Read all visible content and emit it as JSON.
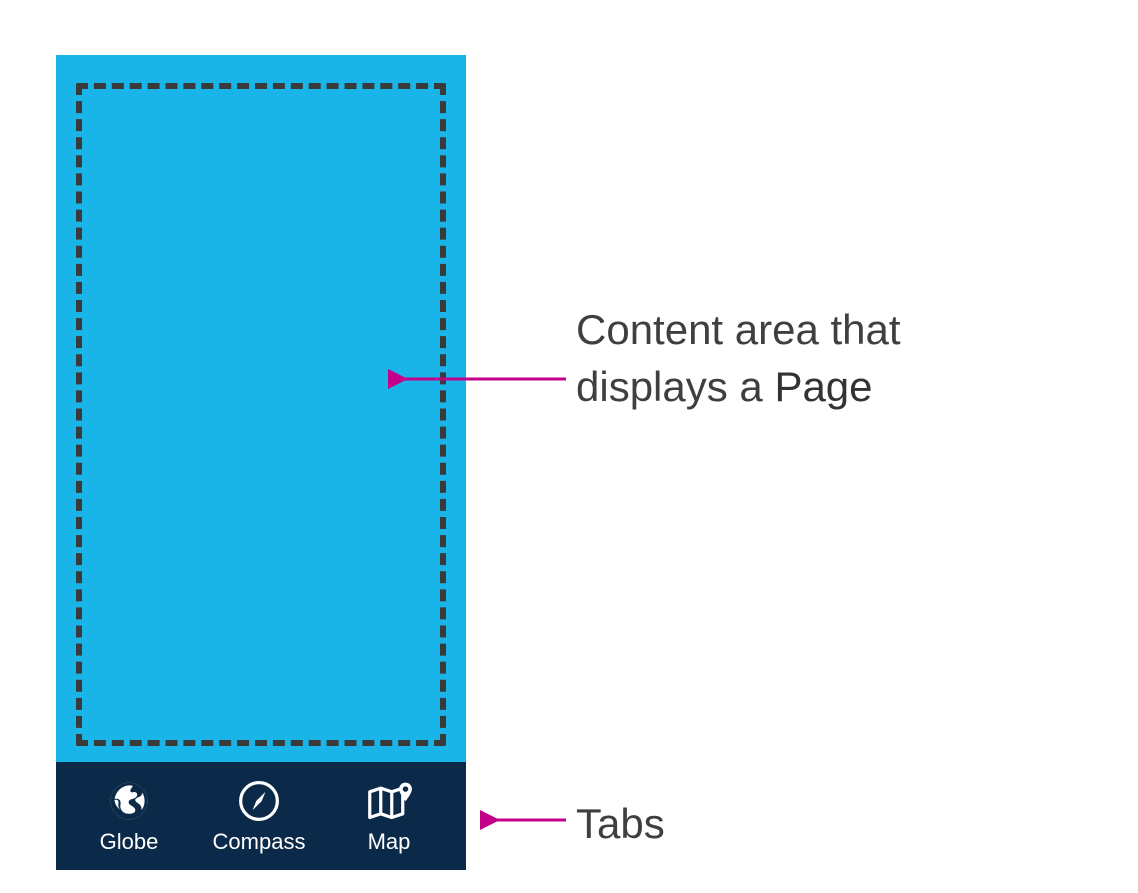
{
  "tabs": [
    {
      "icon": "globe-icon",
      "label": "Globe"
    },
    {
      "icon": "compass-icon",
      "label": "Compass"
    },
    {
      "icon": "map-icon",
      "label": "Map"
    }
  ],
  "annotations": {
    "content_line1": "Content area that",
    "content_line2_prefix": "displays a ",
    "content_line2_bold": "Page",
    "tabs_label": "Tabs"
  },
  "colors": {
    "content_bg": "#1ab5e8",
    "tabbar_bg": "#0b2a4a",
    "dash": "#3a3a3a",
    "arrow": "#c4008b",
    "text": "#3f3f3f"
  }
}
